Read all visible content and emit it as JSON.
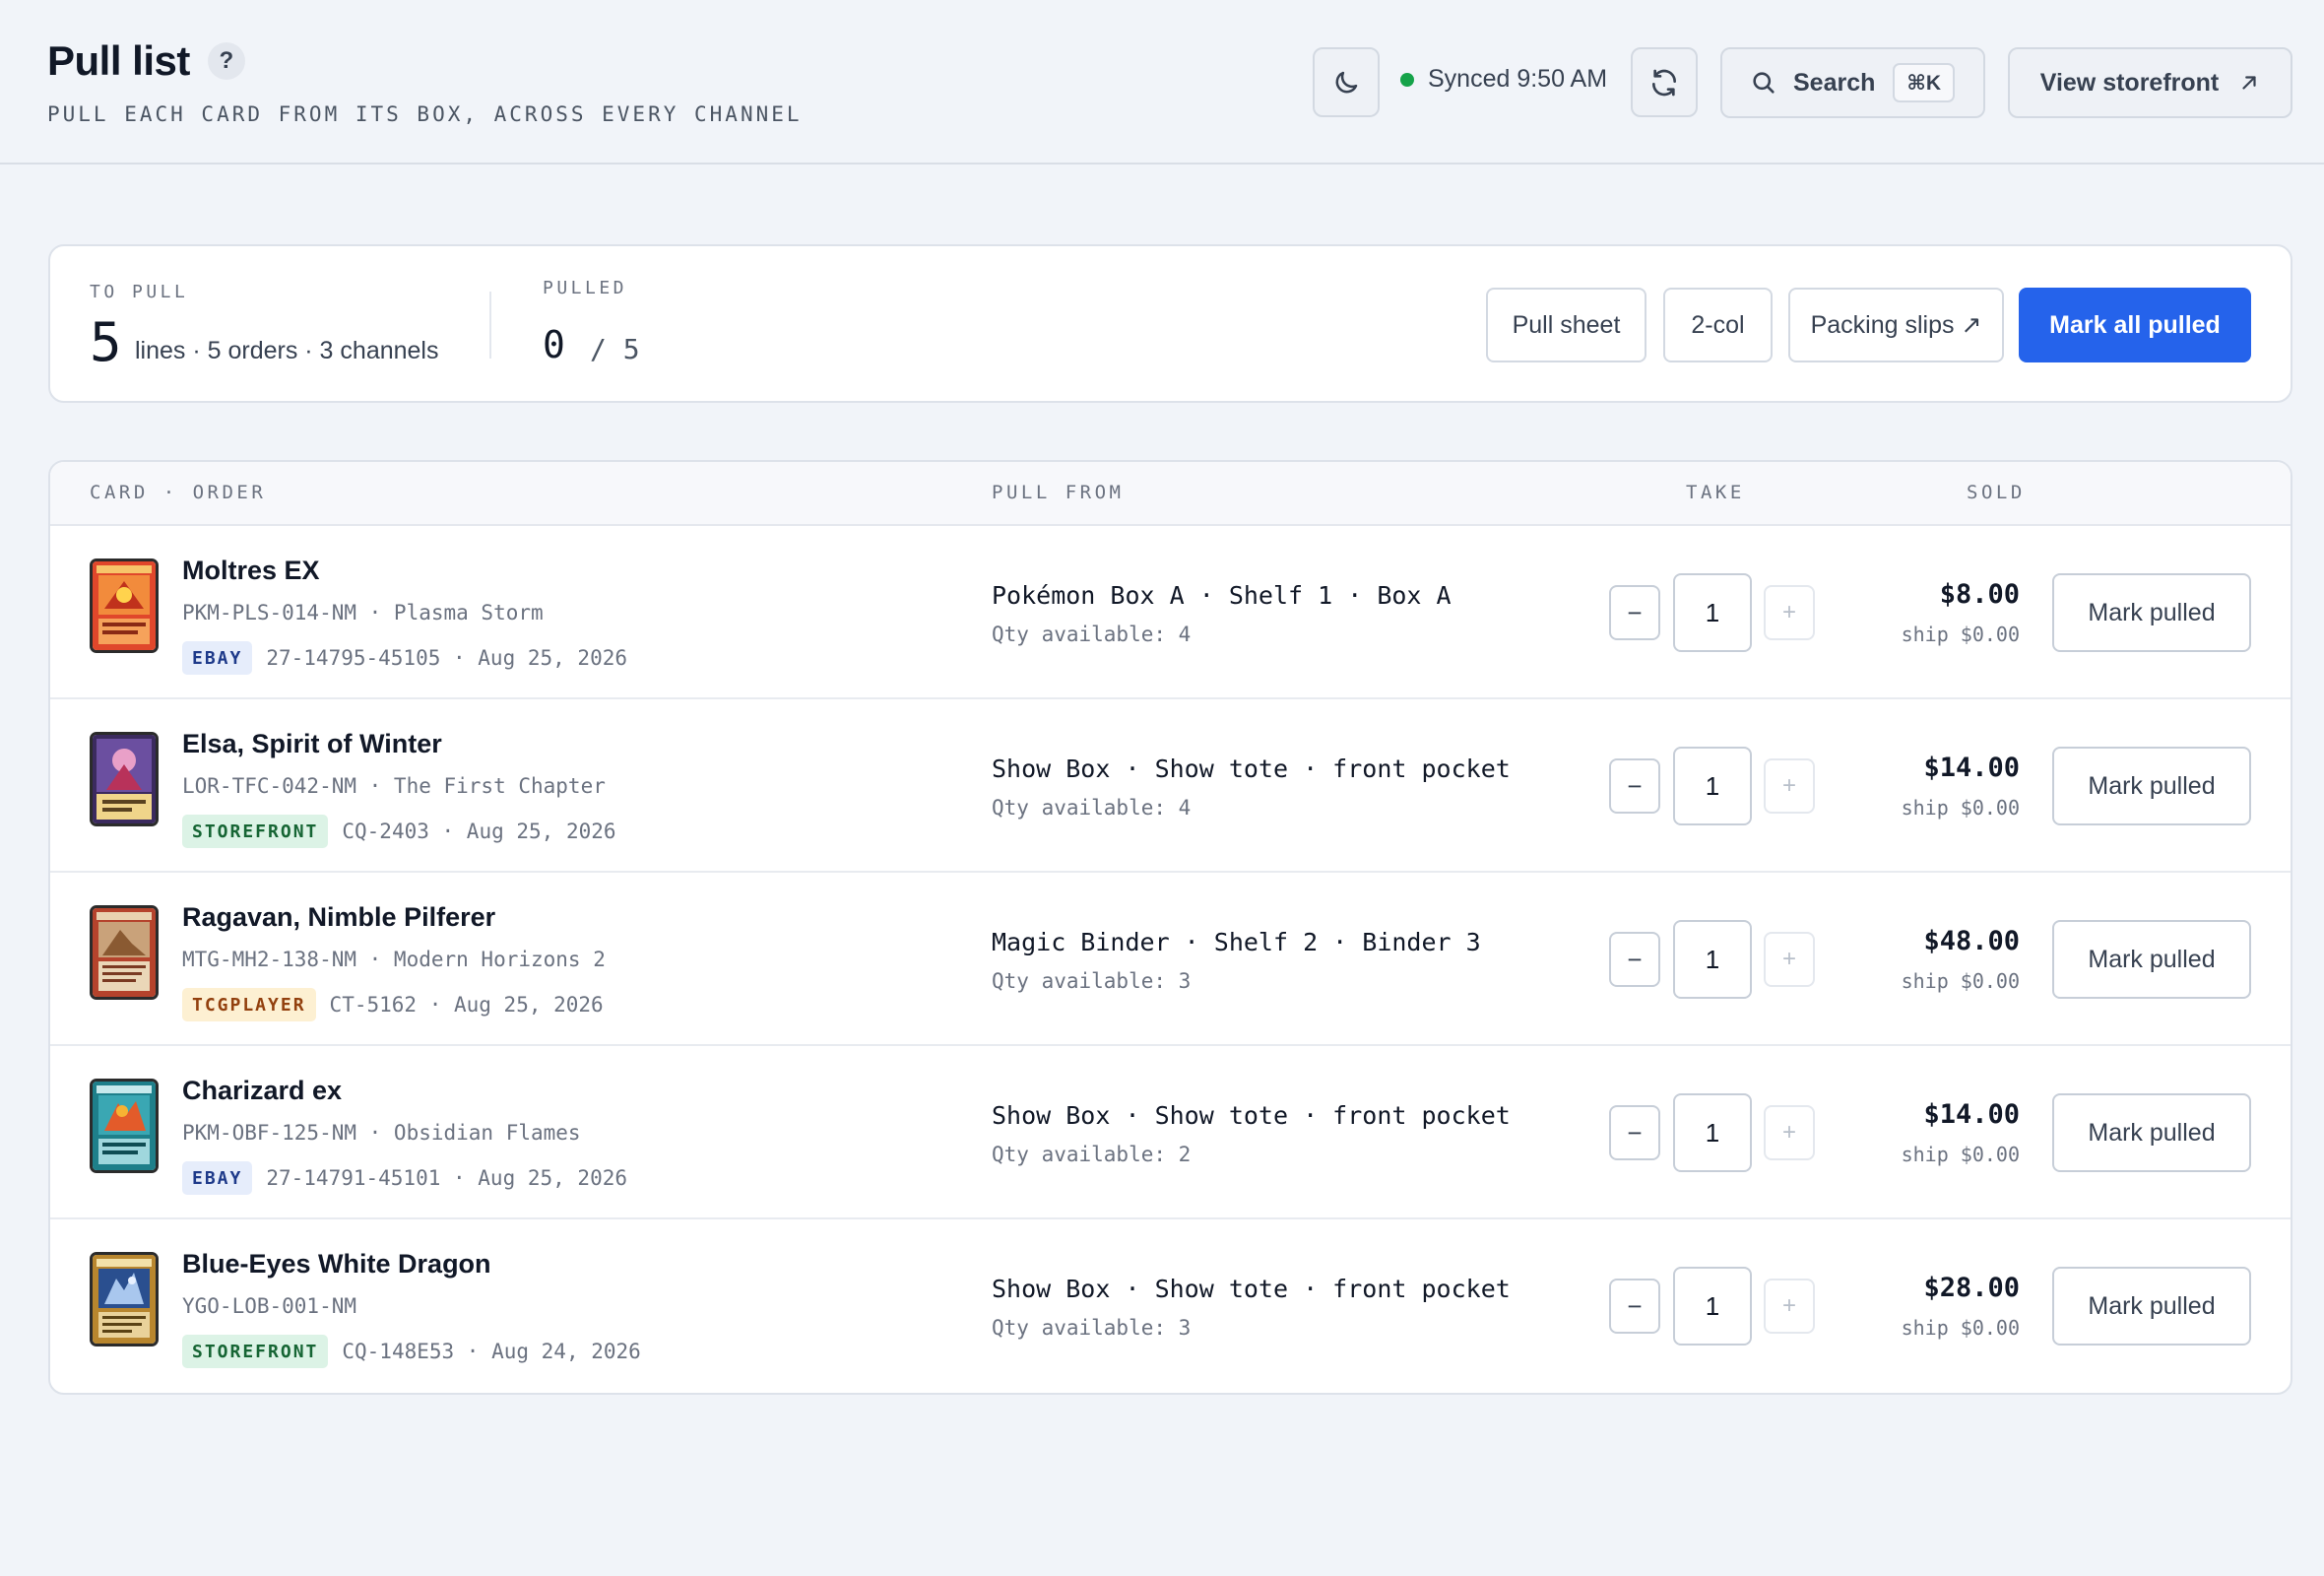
{
  "header": {
    "title": "Pull list",
    "help_label": "?",
    "subtitle": "PULL EACH CARD FROM ITS BOX, ACROSS EVERY CHANNEL",
    "theme_icon": "moon-icon",
    "sync_status": "Synced 9:50 AM",
    "refresh_icon": "refresh-icon",
    "search_label": "Search",
    "search_shortcut": "⌘K",
    "storefront_label": "View storefront"
  },
  "summary": {
    "to_pull_label": "TO PULL",
    "to_pull_count": "5",
    "to_pull_detail": "lines · 5 orders · 3 channels",
    "pulled_label": "PULLED",
    "pulled_value": "0",
    "pulled_total": "/ 5",
    "buttons": {
      "pull_sheet": "Pull sheet",
      "two_col": "2-col",
      "packing_slips": "Packing slips ↗",
      "mark_all": "Mark all pulled"
    }
  },
  "table": {
    "headers": {
      "card_order": "CARD · ORDER",
      "pull_from": "PULL FROM",
      "take": "TAKE",
      "sold": "SOLD"
    },
    "rows": [
      {
        "name": "Moltres EX",
        "sku": "PKM-PLS-014-NM · Plasma Storm",
        "channel": "EBAY",
        "order": "27-14795-45105 · Aug 25, 2026",
        "location": "Pokémon Box A · Shelf 1 · Box A",
        "available": "Qty available: 4",
        "minus": "−",
        "qty": "1",
        "plus": "+",
        "price": "$8.00",
        "ship": "ship $0.00",
        "action": "Mark pulled"
      },
      {
        "name": "Elsa, Spirit of Winter",
        "sku": "LOR-TFC-042-NM · The First Chapter",
        "channel": "STOREFRONT",
        "order": "CQ-2403 · Aug 25, 2026",
        "location": "Show Box · Show tote · front pocket",
        "available": "Qty available: 4",
        "minus": "−",
        "qty": "1",
        "plus": "+",
        "price": "$14.00",
        "ship": "ship $0.00",
        "action": "Mark pulled"
      },
      {
        "name": "Ragavan, Nimble Pilferer",
        "sku": "MTG-MH2-138-NM · Modern Horizons 2",
        "channel": "TCGPLAYER",
        "order": "CT-5162 · Aug 25, 2026",
        "location": "Magic Binder · Shelf 2 · Binder 3",
        "available": "Qty available: 3",
        "minus": "−",
        "qty": "1",
        "plus": "+",
        "price": "$48.00",
        "ship": "ship $0.00",
        "action": "Mark pulled"
      },
      {
        "name": "Charizard ex",
        "sku": "PKM-OBF-125-NM · Obsidian Flames",
        "channel": "EBAY",
        "order": "27-14791-45101 · Aug 25, 2026",
        "location": "Show Box · Show tote · front pocket",
        "available": "Qty available: 2",
        "minus": "−",
        "qty": "1",
        "plus": "+",
        "price": "$14.00",
        "ship": "ship $0.00",
        "action": "Mark pulled"
      },
      {
        "name": "Blue-Eyes White Dragon",
        "sku": "YGO-LOB-001-NM",
        "channel": "STOREFRONT",
        "order": "CQ-148E53 · Aug 24, 2026",
        "location": "Show Box · Show tote · front pocket",
        "available": "Qty available: 3",
        "minus": "−",
        "qty": "1",
        "plus": "+",
        "price": "$28.00",
        "ship": "ship $0.00",
        "action": "Mark pulled"
      }
    ]
  },
  "colors": {
    "accent": "#2563eb",
    "synced": "#16a34a",
    "ebay_badge": "#1e3a8a",
    "storefront_badge": "#166534",
    "tcgplayer_badge": "#92400e"
  }
}
